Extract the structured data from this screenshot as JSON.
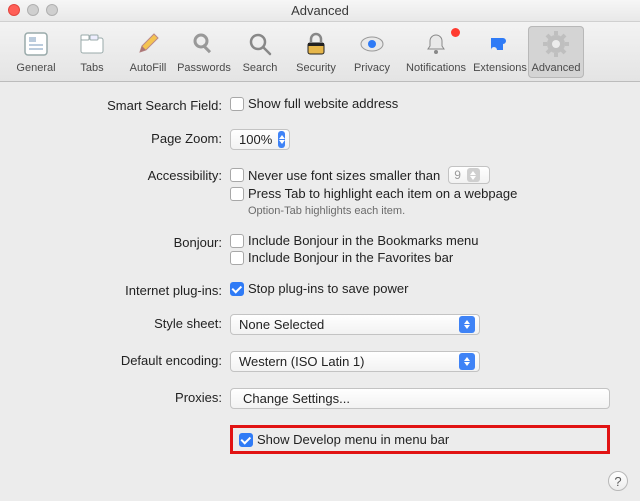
{
  "window": {
    "title": "Advanced"
  },
  "toolbar": {
    "items": [
      {
        "id": "general",
        "label": "General"
      },
      {
        "id": "tabs",
        "label": "Tabs"
      },
      {
        "id": "autofill",
        "label": "AutoFill"
      },
      {
        "id": "passwords",
        "label": "Passwords"
      },
      {
        "id": "search",
        "label": "Search"
      },
      {
        "id": "security",
        "label": "Security"
      },
      {
        "id": "privacy",
        "label": "Privacy"
      },
      {
        "id": "notifications",
        "label": "Notifications"
      },
      {
        "id": "extensions",
        "label": "Extensions"
      },
      {
        "id": "advanced",
        "label": "Advanced"
      }
    ]
  },
  "sections": {
    "smart_search": {
      "label": "Smart Search Field:",
      "show_full_address": {
        "checked": false,
        "label": "Show full website address"
      }
    },
    "page_zoom": {
      "label": "Page Zoom:",
      "value": "100%"
    },
    "accessibility": {
      "label": "Accessibility:",
      "min_font": {
        "checked": false,
        "label": "Never use font sizes smaller than",
        "value": "9"
      },
      "press_tab": {
        "checked": false,
        "label": "Press Tab to highlight each item on a webpage"
      },
      "hint": "Option-Tab highlights each item."
    },
    "bonjour": {
      "label": "Bonjour:",
      "bookmarks": {
        "checked": false,
        "label": "Include Bonjour in the Bookmarks menu"
      },
      "favorites": {
        "checked": false,
        "label": "Include Bonjour in the Favorites bar"
      }
    },
    "plugins": {
      "label": "Internet plug-ins:",
      "stop_to_save_power": {
        "checked": true,
        "label": "Stop plug-ins to save power"
      }
    },
    "style_sheet": {
      "label": "Style sheet:",
      "value": "None Selected"
    },
    "default_encoding": {
      "label": "Default encoding:",
      "value": "Western (ISO Latin 1)"
    },
    "proxies": {
      "label": "Proxies:",
      "button": "Change Settings..."
    },
    "develop": {
      "checked": true,
      "label": "Show Develop menu in menu bar"
    }
  },
  "help_button": "?"
}
